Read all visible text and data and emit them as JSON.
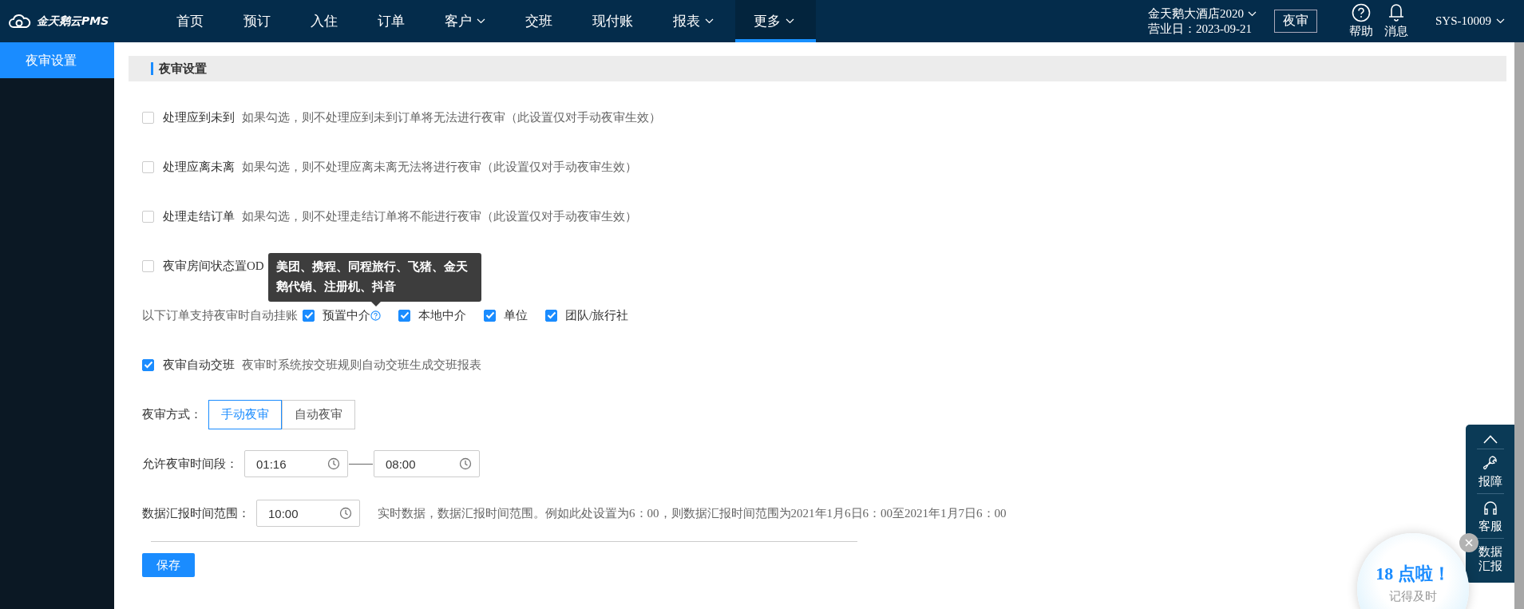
{
  "topbar": {
    "logo": "金天鹅云PMS",
    "nav": [
      {
        "label": "首页",
        "has_menu": false,
        "selected": false
      },
      {
        "label": "预订",
        "has_menu": false,
        "selected": false
      },
      {
        "label": "入住",
        "has_menu": false,
        "selected": false
      },
      {
        "label": "订单",
        "has_menu": false,
        "selected": false
      },
      {
        "label": "客户",
        "has_menu": true,
        "selected": false
      },
      {
        "label": "交班",
        "has_menu": false,
        "selected": false
      },
      {
        "label": "现付账",
        "has_menu": false,
        "selected": false
      },
      {
        "label": "报表",
        "has_menu": true,
        "selected": false
      },
      {
        "label": "更多",
        "has_menu": true,
        "selected": true
      }
    ],
    "hotel": "金天鹅大酒店2020",
    "business_date": "营业日：2023-09-21",
    "audit_button": "夜审",
    "help": "帮助",
    "messages": "消息",
    "user": "SYS-10009"
  },
  "sidebar": {
    "items": [
      {
        "label": "夜审设置",
        "selected": true
      }
    ]
  },
  "section_title": "夜审设置",
  "options": [
    {
      "label": "处理应到未到",
      "description": "如果勾选，则不处理应到未到订单将无法进行夜审（此设置仅对手动夜审生效）",
      "checked": false
    },
    {
      "label": "处理应离未离",
      "description": "如果勾选，则不处理应离未离无法将进行夜审（此设置仅对手动夜审生效）",
      "checked": false
    },
    {
      "label": "处理走结订单",
      "description": "如果勾选，则不处理走结订单将不能进行夜审（此设置仅对手动夜审生效）",
      "checked": false
    },
    {
      "label": "夜审房间状态置OD",
      "checked": false
    }
  ],
  "auto_post": {
    "label": "以下订单支持夜审时自动挂账",
    "tooltip": "美团、携程、同程旅行、飞猪、金天鹅代销、注册机、抖音",
    "items": [
      {
        "label": "预置中介",
        "checked": true,
        "has_help": true
      },
      {
        "label": "本地中介",
        "checked": true,
        "has_help": false
      },
      {
        "label": "单位",
        "checked": true,
        "has_help": false
      },
      {
        "label": "团队/旅行社",
        "checked": true,
        "has_help": false
      }
    ]
  },
  "auto_shift": {
    "label": "夜审自动交班",
    "description": "夜审时系统按交班规则自动交班生成交班报表",
    "checked": true
  },
  "mode": {
    "label": "夜审方式：",
    "options": [
      {
        "label": "手动夜审",
        "selected": true
      },
      {
        "label": "自动夜审",
        "selected": false
      }
    ]
  },
  "time_window": {
    "label": "允许夜审时间段：",
    "start": "01:16",
    "end": "08:00"
  },
  "report_time": {
    "label": "数据汇报时间范围：",
    "value": "10:00",
    "note": "实时数据，数据汇报时间范围。例如此处设置为6：00，则数据汇报时间范围为2021年1月6日6：00至2021年1月7日6：00"
  },
  "save": "保存",
  "float_tools": {
    "items": [
      {
        "kind": "top"
      },
      {
        "kind": "repair",
        "label": "报障"
      },
      {
        "kind": "service",
        "label": "客服"
      },
      {
        "kind": "data",
        "label": "数据汇报"
      }
    ]
  },
  "promo": {
    "headline": "18 点啦！",
    "text": "记得及时"
  }
}
